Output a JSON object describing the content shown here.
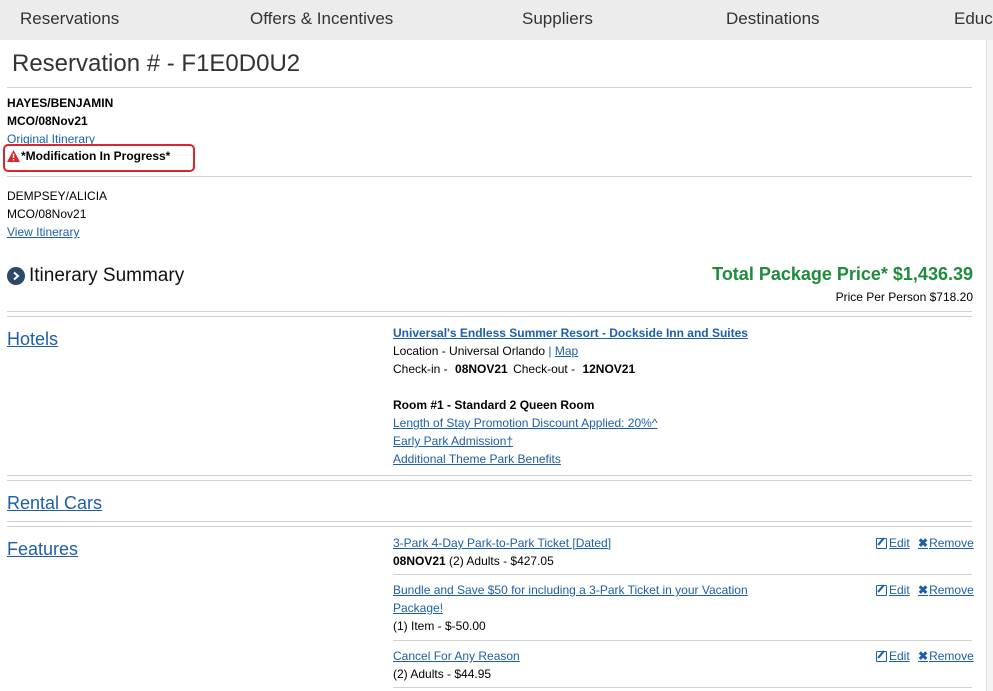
{
  "nav": {
    "items": [
      "Reservations",
      "Offers & Incentives",
      "Suppliers",
      "Destinations",
      "Education"
    ]
  },
  "reservation": {
    "title": "Reservation # - F1E0D0U2"
  },
  "guest1": {
    "name": "HAYES/BENJAMIN",
    "trip": "MCO/08Nov21",
    "link": "Original Itinerary",
    "status": "*Modification In Progress*"
  },
  "guest2": {
    "name": "DEMPSEY/ALICIA",
    "trip": "MCO/08Nov21",
    "link": "View Itinerary"
  },
  "summary": {
    "title": "Itinerary Summary",
    "total": "Total Package Price* $1,436.39",
    "per_person": "Price Per Person $718.20"
  },
  "hotels": {
    "label": "Hotels",
    "name": "Universal's Endless Summer Resort - Dockside Inn and Suites",
    "location_label": "Location - Universal Orlando",
    "sep": "|",
    "map": "Map",
    "checkin_label": "Check-in -",
    "checkin_value": "08NOV21",
    "checkout_label": "Check-out -",
    "checkout_value": "12NOV21",
    "room": "Room #1 - Standard 2 Queen Room",
    "links": [
      "Length of Stay Promotion Discount Applied: 20%^",
      "Early Park Admission†",
      "Additional Theme Park Benefits"
    ]
  },
  "rental": {
    "label": "Rental Cars"
  },
  "features": {
    "label": "Features",
    "edit": "Edit",
    "remove": "Remove",
    "items": [
      {
        "name": "3-Park 4-Day Park-to-Park Ticket [Dated]",
        "date": "08NOV21",
        "detail": "(2) Adults - $427.05"
      },
      {
        "name_line1": "Bundle and Save $50 for including a 3-Park Ticket in your Vacation",
        "name_line2": "Package!",
        "detail": "(1) Item - $-50.00"
      },
      {
        "name": "Cancel For Any Reason",
        "detail": "(2) Adults - $44.95"
      }
    ]
  },
  "colors": {
    "link": "#1d5fa8",
    "total_green": "#1e8c3b",
    "alert_red": "#e0242c",
    "nav_bg": "#ececec"
  }
}
